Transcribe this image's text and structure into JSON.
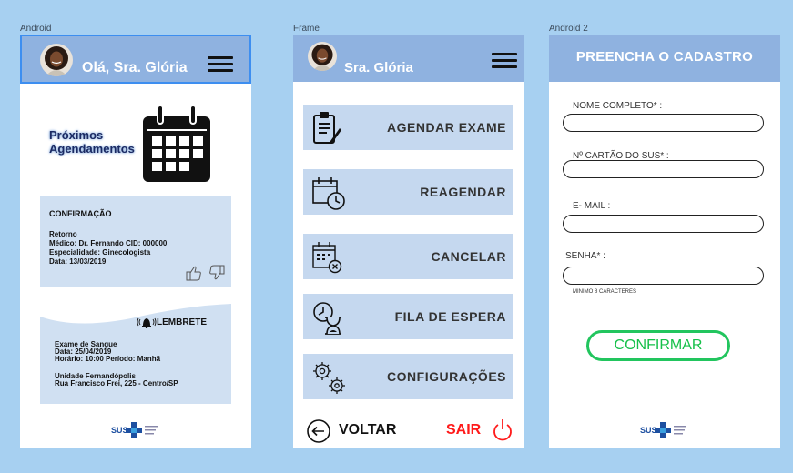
{
  "frames": {
    "s1_label": "Android",
    "s2_label": "Frame",
    "s3_label": "Android 2"
  },
  "home": {
    "greeting": "Olá, Sra. Glória",
    "next_title_line1": "Próximos",
    "next_title_line2": "Agendamentos",
    "confirmation": {
      "title": "CONFIRMAÇÃO",
      "lines": [
        "Retorno",
        "Médico:  Dr. Fernando   CID: 000000",
        "Especialidade: Ginecologista",
        "Data: 13/03/2019"
      ]
    },
    "reminder": {
      "title": "LEMBRETE",
      "lines": [
        "Exame de Sangue",
        "Data: 25/04/2019",
        "Horário: 10:00  Período: Manhã",
        "",
        "Unidade Fernandópolis",
        "Rua Francisco Frei, 225 - Centro/SP"
      ]
    },
    "logo_text": "SUS"
  },
  "menu": {
    "greeting": "Sra. Glória",
    "items": [
      {
        "label": "AGENDAR EXAME",
        "icon": "clipboard-icon"
      },
      {
        "label": "REAGENDAR",
        "icon": "calendar-clock-icon"
      },
      {
        "label": "CANCELAR",
        "icon": "calendar-cancel-icon"
      },
      {
        "label": "FILA DE ESPERA",
        "icon": "hourglass-clock-icon"
      },
      {
        "label": "CONFIGURAÇÕES",
        "icon": "gears-icon"
      }
    ],
    "back_label": "VOLTAR",
    "exit_label": "SAIR"
  },
  "register": {
    "title": "PREENCHA O CADASTRO",
    "fields": [
      {
        "label": "NOME COMPLETO* :"
      },
      {
        "label": "Nº CARTÃO DO SUS* :"
      },
      {
        "label": "E- MAIL :"
      },
      {
        "label": "SENHA* :"
      }
    ],
    "password_hint": "MINIMO 8 CARACTERES",
    "confirm_label": "CONFIRMAR",
    "logo_text": "SUS"
  },
  "colors": {
    "background": "#a7d0f1",
    "header": "#8fb2e0",
    "card": "#d0e0f2",
    "confirm": "#22c55e",
    "exit": "#ff1a1a"
  }
}
